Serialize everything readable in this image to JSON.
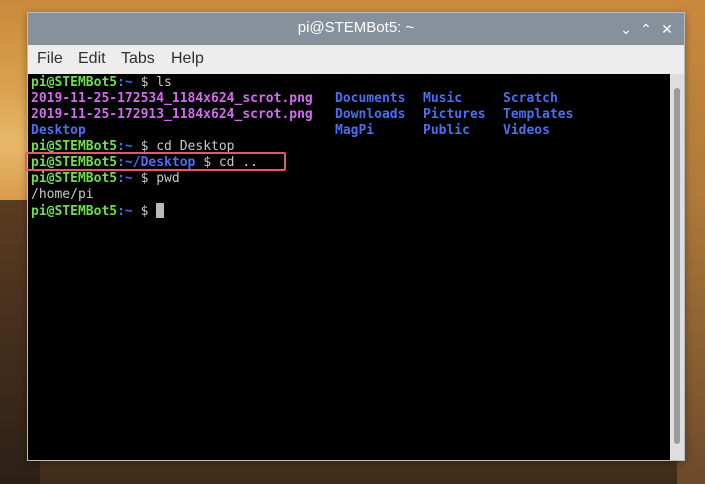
{
  "window": {
    "title": "pi@STEMBot5: ~"
  },
  "titlebar_buttons": {
    "minimize": "⌄",
    "maximize": "⌃",
    "close": "✕"
  },
  "menu": [
    "File",
    "Edit",
    "Tabs",
    "Help"
  ],
  "terminal": {
    "prompt_user": "pi@STEMBot5",
    "lines": [
      {
        "path": ":~",
        "cmd": " $ ls"
      },
      {
        "files_row1": [
          "2019-11-25-172534_1184x624_scrot.png",
          "Documents",
          "Music",
          "Scratch"
        ]
      },
      {
        "files_row2": [
          "2019-11-25-172913_1184x624_scrot.png",
          "Downloads",
          "Pictures",
          "Templates"
        ]
      },
      {
        "files_row3": [
          "Desktop",
          "MagPi",
          "Public",
          "Videos"
        ]
      },
      {
        "path": ":~",
        "cmd": " $ cd Desktop"
      },
      {
        "path": ":~/Desktop",
        "cmd": " $ cd .."
      },
      {
        "path": ":~",
        "cmd": " $ pwd"
      },
      {
        "output": "/home/pi"
      },
      {
        "path": ":~",
        "cmd": " $ "
      }
    ]
  }
}
